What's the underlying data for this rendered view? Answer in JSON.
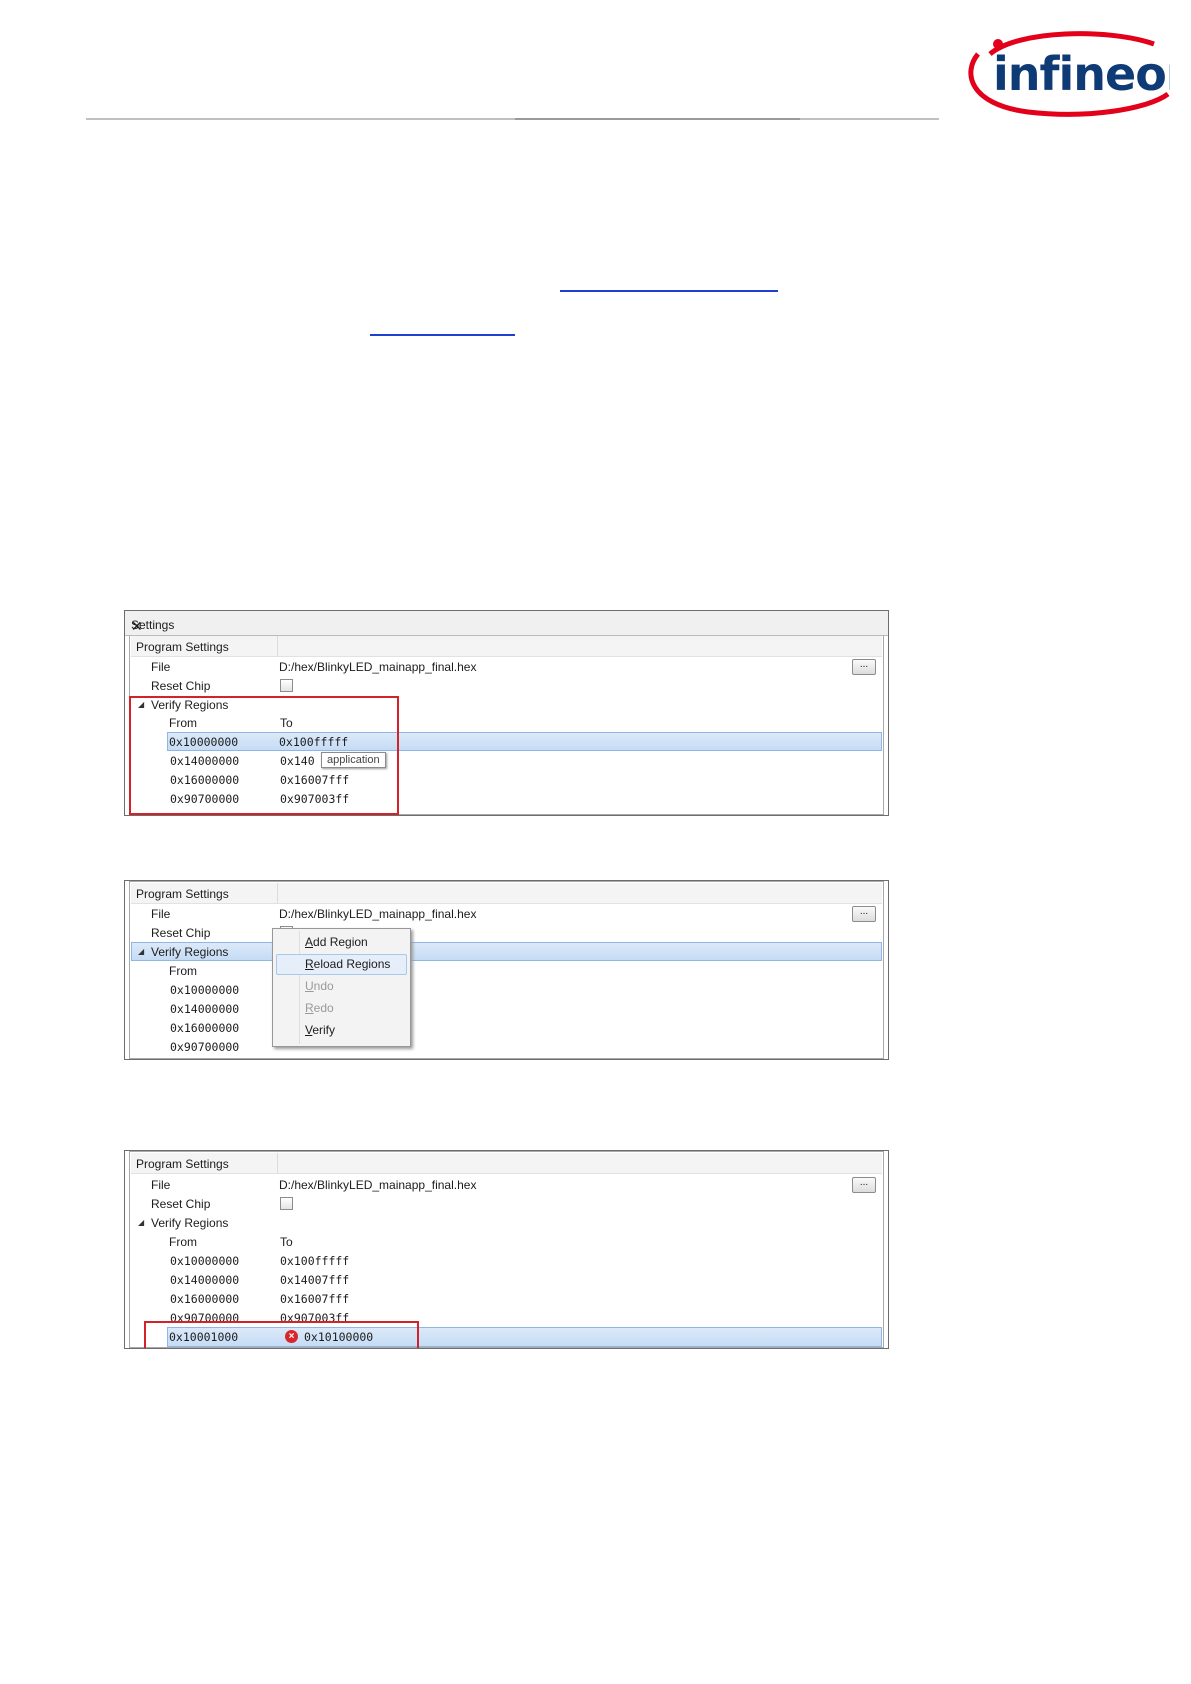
{
  "brand": {
    "logo_text": "infineon",
    "accent": "#e2001a",
    "logo_color": "#0e3a75"
  },
  "panel1": {
    "title": "Settings",
    "section": "Program Settings",
    "file_label": "File",
    "file_value": "D:/hex/BlinkyLED_mainapp_final.hex",
    "browse_label": "...",
    "reset_label": "Reset Chip",
    "verify_label": "Verify Regions",
    "from_header": "From",
    "to_header": "To",
    "regions": [
      {
        "from": "0x10000000",
        "to": "0x100fffff"
      },
      {
        "from": "0x14000000",
        "to": "0x140"
      },
      {
        "from": "0x16000000",
        "to": "0x16007fff"
      },
      {
        "from": "0x90700000",
        "to": "0x907003ff"
      }
    ],
    "tooltip": "application"
  },
  "panel2": {
    "section": "Program Settings",
    "file_label": "File",
    "file_value": "D:/hex/BlinkyLED_mainapp_final.hex",
    "browse_label": "...",
    "reset_label": "Reset Chip",
    "verify_label": "Verify Regions",
    "from_header": "From",
    "regions": [
      "0x10000000",
      "0x14000000",
      "0x16000000",
      "0x90700000"
    ],
    "menu": {
      "add_first": "A",
      "add_rest": "dd Region",
      "reload_first": "R",
      "reload_rest": "eload Regions",
      "undo_first": "U",
      "undo_rest": "ndo",
      "redo_first": "R",
      "redo_rest": "edo",
      "verify_first": "V",
      "verify_rest": "erify"
    }
  },
  "panel3": {
    "section": "Program Settings",
    "file_label": "File",
    "file_value": "D:/hex/BlinkyLED_mainapp_final.hex",
    "browse_label": "...",
    "reset_label": "Reset Chip",
    "verify_label": "Verify Regions",
    "from_header": "From",
    "to_header": "To",
    "regions": [
      {
        "from": "0x10000000",
        "to": "0x100fffff"
      },
      {
        "from": "0x14000000",
        "to": "0x14007fff"
      },
      {
        "from": "0x16000000",
        "to": "0x16007fff"
      },
      {
        "from": "0x90700000",
        "to": "0x907003ff"
      }
    ],
    "new_from": "0x10001000",
    "new_to": "0x10100000",
    "error_icon": "×"
  }
}
